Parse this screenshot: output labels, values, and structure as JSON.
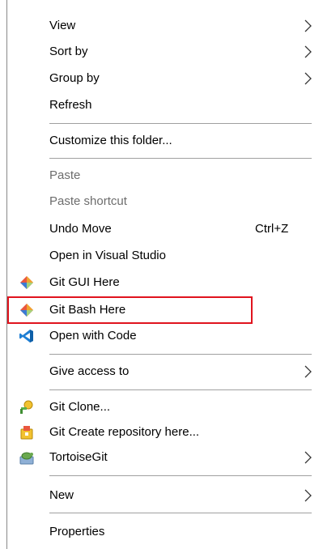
{
  "menu": {
    "view": "View",
    "sort_by": "Sort by",
    "group_by": "Group by",
    "refresh": "Refresh",
    "customize": "Customize this folder...",
    "paste": "Paste",
    "paste_shortcut": "Paste shortcut",
    "undo_move": "Undo Move",
    "undo_shortcut": "Ctrl+Z",
    "open_vs": "Open in Visual Studio",
    "git_gui": "Git GUI Here",
    "git_bash": "Git Bash Here",
    "open_code": "Open with Code",
    "give_access": "Give access to",
    "git_clone": "Git Clone...",
    "git_create": "Git Create repository here...",
    "tortoisegit": "TortoiseGit",
    "new": "New",
    "properties": "Properties"
  },
  "colors": {
    "highlight_border": "#e0141e",
    "separator": "#a0a0a0",
    "disabled_text": "#6d6d6d"
  }
}
